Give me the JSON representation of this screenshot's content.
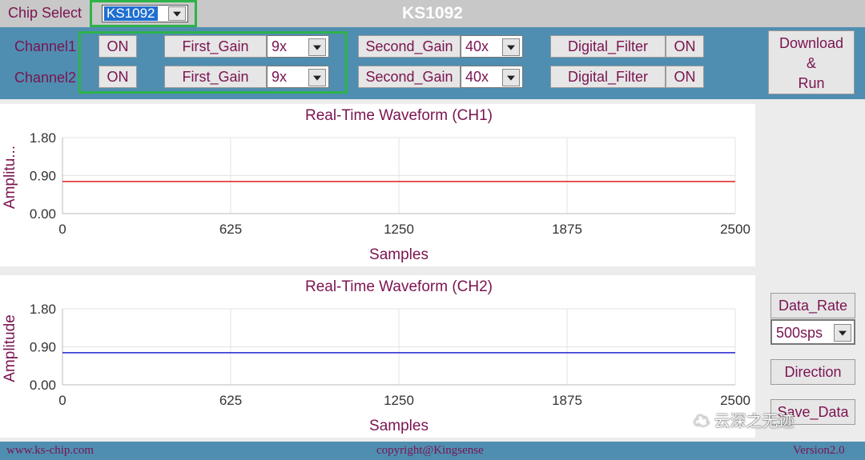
{
  "header": {
    "chip_select_label": "Chip Select",
    "chip_select_value": "KS1092",
    "title": "KS1092"
  },
  "channels": [
    {
      "label": "Channel1",
      "state": "ON",
      "first_gain_label": "First_Gain",
      "first_gain": "9x",
      "second_gain_label": "Second_Gain",
      "second_gain": "40x",
      "filter_label": "Digital_Filter",
      "filter_state": "ON"
    },
    {
      "label": "Channel2",
      "state": "ON",
      "first_gain_label": "First_Gain",
      "first_gain": "9x",
      "second_gain_label": "Second_Gain",
      "second_gain": "40x",
      "filter_label": "Digital_Filter",
      "filter_state": "ON"
    }
  ],
  "download": {
    "line1": "Download",
    "line2": "&",
    "line3": "Run"
  },
  "right_panel": {
    "data_rate_label": "Data_Rate",
    "data_rate_value": "500sps",
    "direction_label": "Direction",
    "save_label": "Save_Data"
  },
  "chart_data": [
    {
      "type": "line",
      "title": "Real-Time Waveform (CH1)",
      "xlabel": "Samples",
      "ylabel": "Amplitu...",
      "xlim": [
        0,
        2500
      ],
      "ylim": [
        0,
        1.8
      ],
      "xticks": [
        "0",
        "625",
        "1250",
        "1875",
        "2500"
      ],
      "yticks": [
        "1.80",
        "0.90",
        "0.00"
      ],
      "grid": true,
      "series": [
        {
          "color": "#e02020",
          "x": [
            0,
            2500
          ],
          "y": [
            0.76,
            0.76
          ]
        }
      ]
    },
    {
      "type": "line",
      "title": "Real-Time Waveform (CH2)",
      "xlabel": "Samples",
      "ylabel": "Amplitude",
      "xlim": [
        0,
        2500
      ],
      "ylim": [
        0,
        1.8
      ],
      "xticks": [
        "0",
        "625",
        "1250",
        "1875",
        "2500"
      ],
      "yticks": [
        "1.80",
        "0.90",
        "0.00"
      ],
      "grid": true,
      "series": [
        {
          "color": "#2020d0",
          "x": [
            0,
            2500
          ],
          "y": [
            0.76,
            0.76
          ]
        }
      ]
    }
  ],
  "footer": {
    "left": "www.ks-chip.com",
    "center": "copyright@Kingsense",
    "right": "Version2.0"
  },
  "watermark": "云深之无迹",
  "colors": {
    "band": "#4f8eb1",
    "label": "#7a1450",
    "highlight": "#2db34a"
  }
}
